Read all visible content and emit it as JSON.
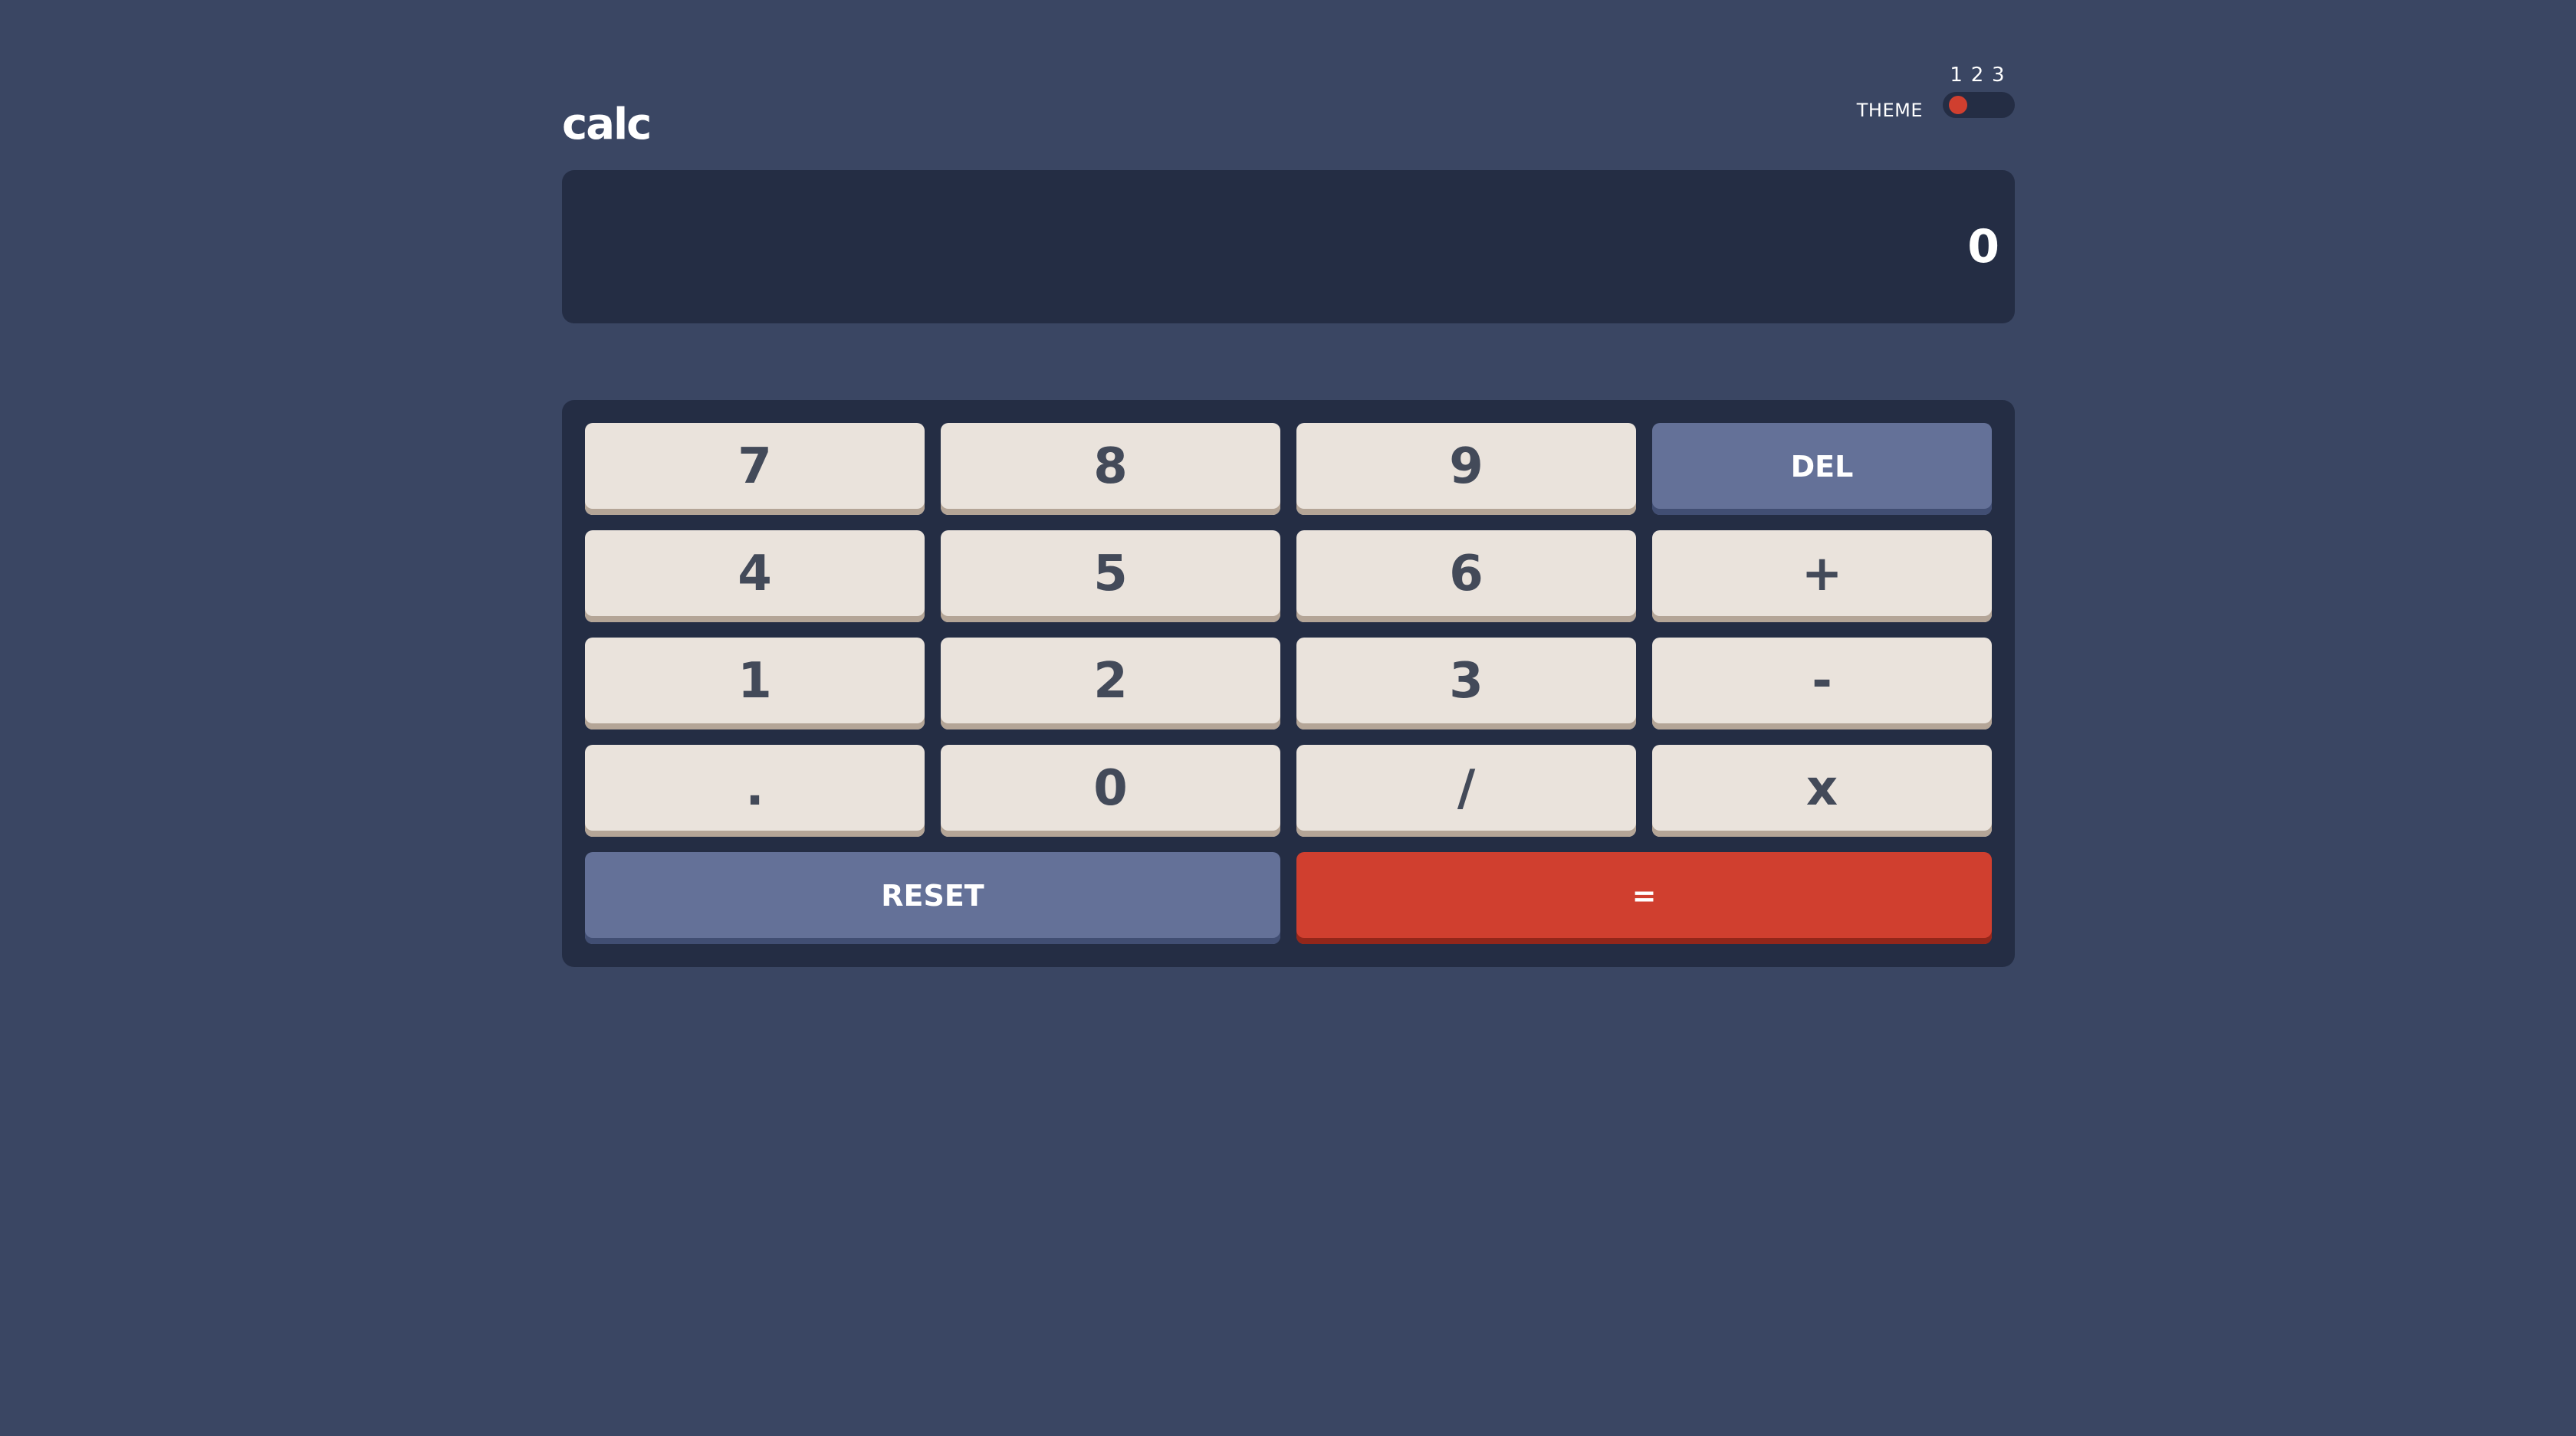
{
  "header": {
    "logo": "calc",
    "theme_label": "THEME",
    "theme_options": [
      "1",
      "2",
      "3"
    ],
    "theme_selected": 1
  },
  "screen": {
    "value": "0"
  },
  "keypad": {
    "keys": [
      "7",
      "8",
      "9",
      "DEL",
      "4",
      "5",
      "6",
      "+",
      "1",
      "2",
      "3",
      "-",
      ".",
      "0",
      "/",
      "x",
      "RESET",
      "="
    ]
  },
  "colors": {
    "background": "#3a4663",
    "screen": "#242d44",
    "key": "#eae3dc",
    "key_text": "#434a59",
    "accent_blue": "#647198",
    "accent_red": "#d03f2f"
  }
}
